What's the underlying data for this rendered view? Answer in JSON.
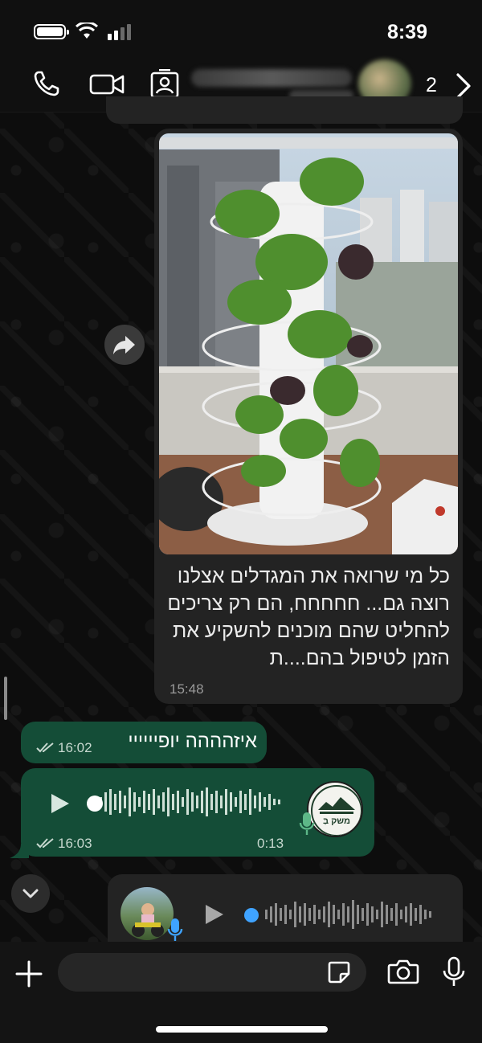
{
  "status_bar": {
    "time": "8:39"
  },
  "header": {
    "unread_count": "2"
  },
  "messages": {
    "image_message": {
      "caption": "כל מי שרואה את המגדלים אצלנו רוצה גם...   חחחחח, הם רק צריכים להחליט שהם מוכנים להשקיע את הזמן לטיפול בהם....ת",
      "time": "15:48"
    },
    "text_message": {
      "text": "איזהההה יופיייייי",
      "time": "16:02"
    },
    "voice_message": {
      "duration": "0:13",
      "time": "16:03",
      "avatar_logo_text": "משק בַּ"
    }
  },
  "composer": {
    "placeholder": ""
  },
  "icons": {
    "phone": "phone-icon",
    "video": "video-icon",
    "contact": "contact-card-icon",
    "chevron": "chevron-right-icon",
    "forward": "forward-icon",
    "play": "play-icon",
    "mic": "mic-icon",
    "plus": "plus-icon",
    "sticker": "sticker-icon",
    "camera": "camera-icon",
    "scroll": "chevron-down-icon"
  },
  "colors": {
    "outgoing_bubble": "#144d37",
    "incoming_bubble": "#232323",
    "accent_blue": "#3fa3ff"
  }
}
